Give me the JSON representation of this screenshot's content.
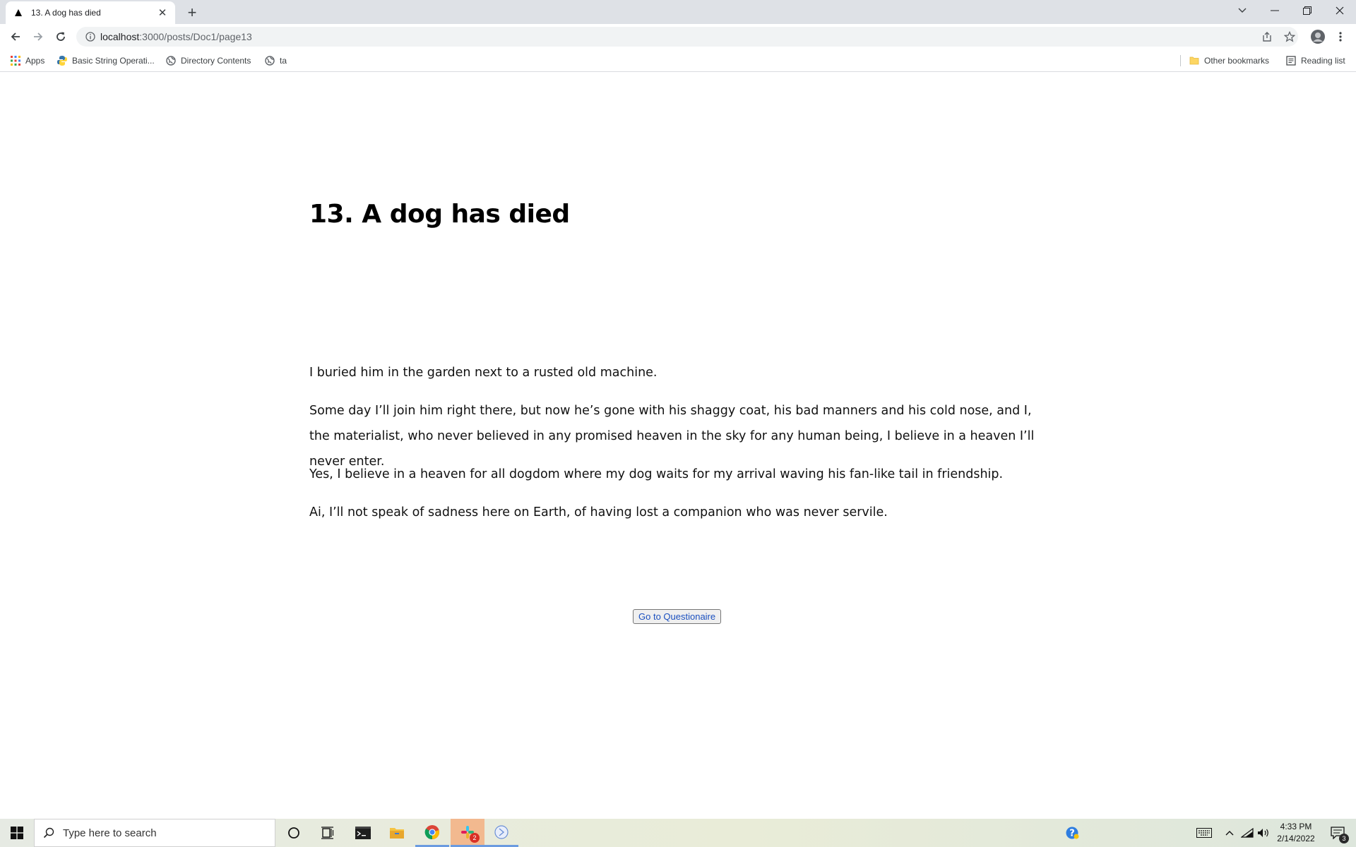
{
  "browser": {
    "tab_title": "13. A dog has died",
    "url_host": "localhost",
    "url_path": ":3000/posts/Doc1/page13",
    "bookmarks": [
      {
        "label": "Apps",
        "icon": "apps-grid-icon"
      },
      {
        "label": "Basic String Operati...",
        "icon": "python-icon"
      },
      {
        "label": "Directory Contents",
        "icon": "globe-icon"
      },
      {
        "label": "ta",
        "icon": "globe-icon"
      }
    ],
    "other_bookmarks": "Other bookmarks",
    "reading_list": "Reading list"
  },
  "page": {
    "title": "13. A dog has died",
    "paragraphs": [
      "I buried him in the garden next to a rusted old machine.",
      "Some day I’ll join him right there, but now he’s gone with his shaggy coat, his bad manners and his cold nose, and I, the materialist, who never believed in any promised heaven in the sky for any human being, I believe in a heaven I’ll never enter.",
      "Yes, I believe in a heaven for all dogdom where my dog waits for my arrival waving his fan-like tail in friendship.",
      "Ai, I’ll not speak of sadness here on Earth, of having lost a companion who was never servile."
    ],
    "button_label": "Go to Questionaire"
  },
  "taskbar": {
    "search_placeholder": "Type here to search",
    "time": "4:33 PM",
    "date": "2/14/2022",
    "notification_count": "3",
    "app_badge": "2"
  },
  "colors": {
    "link_button_text": "#1a4fbf",
    "chrome_tabbar": "#dee1e6",
    "omnibox": "#f1f3f4"
  }
}
